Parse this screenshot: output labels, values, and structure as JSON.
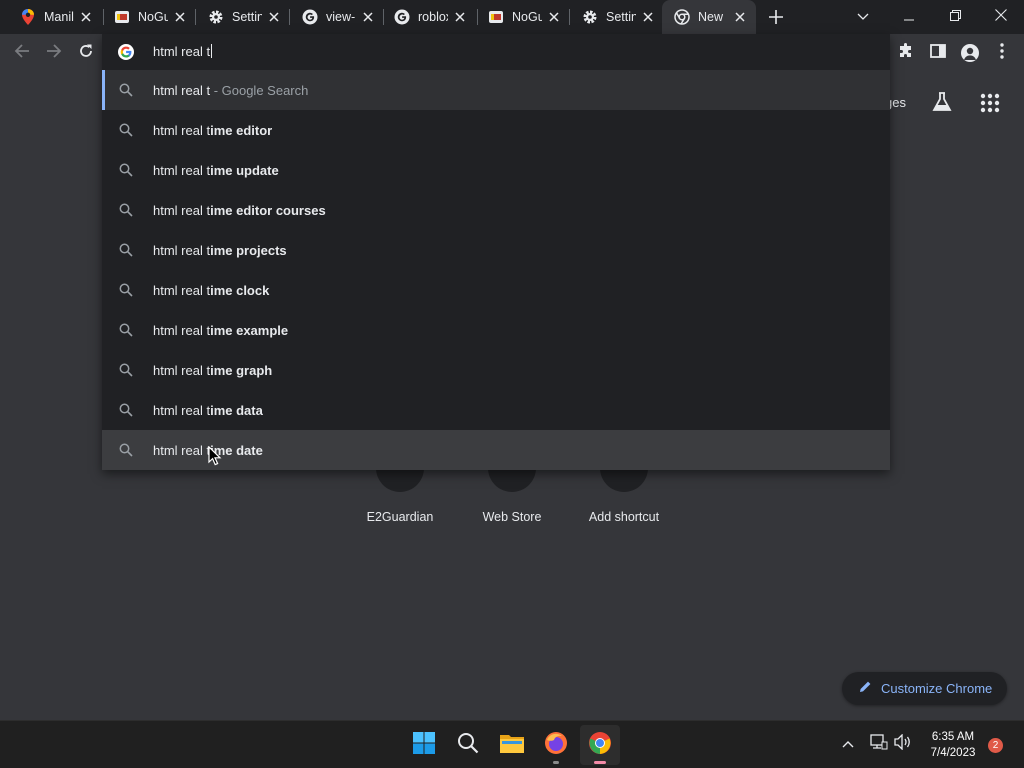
{
  "tabs": [
    {
      "title": "Manila",
      "icon": "maps-pin-icon"
    },
    {
      "title": "NoGuardian",
      "icon": "nog-icon"
    },
    {
      "title": "Settings",
      "icon": "gear-icon"
    },
    {
      "title": "view-",
      "icon": "google-g-icon"
    },
    {
      "title": "roblox",
      "icon": "google-g-icon"
    },
    {
      "title": "NoGuardian",
      "icon": "nog-icon"
    },
    {
      "title": "Settings",
      "icon": "gear-icon"
    },
    {
      "title": "New Tab",
      "icon": "chrome-icon",
      "active": true
    }
  ],
  "omnibox": {
    "typed_text": "html real t",
    "suggestions": [
      {
        "prefix": "html real t",
        "suffix": " - Google Search",
        "style": "search"
      },
      {
        "prefix": "html real t",
        "suffix": "ime editor"
      },
      {
        "prefix": "html real t",
        "suffix": "ime update"
      },
      {
        "prefix": "html real t",
        "suffix": "ime editor courses"
      },
      {
        "prefix": "html real t",
        "suffix": "ime projects"
      },
      {
        "prefix": "html real t",
        "suffix": "ime clock"
      },
      {
        "prefix": "html real t",
        "suffix": "ime example"
      },
      {
        "prefix": "html real t",
        "suffix": "ime graph"
      },
      {
        "prefix": "html real t",
        "suffix": "ime data"
      },
      {
        "prefix": "html real t",
        "suffix": "ime date"
      }
    ]
  },
  "page": {
    "images_link": "Images",
    "images_link_visible": "ges",
    "shortcuts": [
      "E2Guardian",
      "Web Store",
      "Add shortcut"
    ],
    "customize_label": "Customize Chrome"
  },
  "taskbar": {
    "time": "6:35 AM",
    "date": "7/4/2023",
    "notifications": "2"
  },
  "colors": {
    "accent": "#8ab4f8",
    "badge": "#e05a48"
  }
}
